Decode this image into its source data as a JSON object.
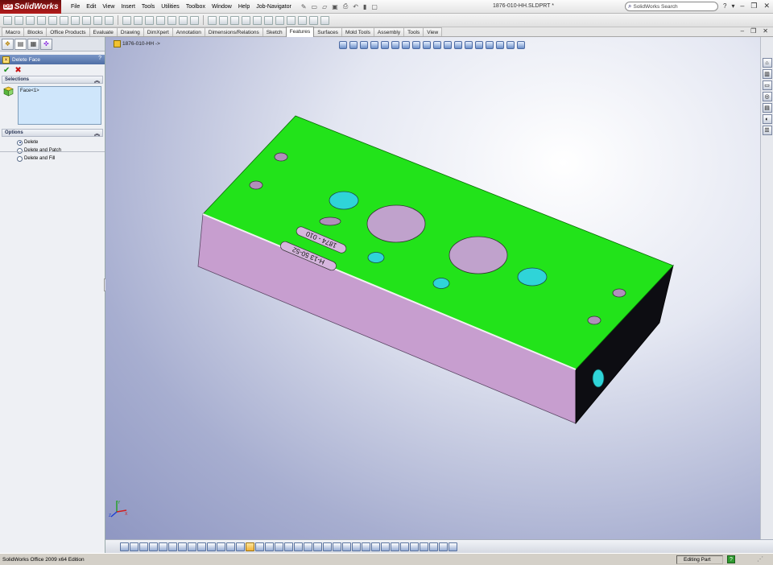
{
  "app": {
    "logo_text": "SolidWorks",
    "logo_mark": "DS",
    "menu": [
      "File",
      "Edit",
      "View",
      "Insert",
      "Tools",
      "Utilities",
      "Toolbox",
      "Window",
      "Help",
      "Job-Navigator"
    ],
    "document_title": "1876-010-HH.SLDPRT *",
    "search_placeholder": "SolidWorks Search",
    "help_glyph": "?"
  },
  "command_tabs": [
    "Macro",
    "Blocks",
    "Office Products",
    "Evaluate",
    "Drawing",
    "DimXpert",
    "Annotation",
    "Dimensions/Relations",
    "Sketch",
    "Features",
    "Surfaces",
    "Mold Tools",
    "Assembly",
    "Tools",
    "View"
  ],
  "active_tab": "Features",
  "property_manager": {
    "title": "Delete Face",
    "ok_glyph": "✔",
    "cancel_glyph": "✖",
    "selections": {
      "header": "Selections",
      "items_text": "Face<1>"
    },
    "options": {
      "header": "Options",
      "choices": [
        {
          "label": "Delete",
          "checked": true
        },
        {
          "label": "Delete and Patch",
          "checked": false
        },
        {
          "label": "Delete and Fill",
          "checked": false
        }
      ]
    }
  },
  "viewport": {
    "breadcrumb": "1876-010-HH ->",
    "engraving_1": "1874 - 010",
    "engraving_2": "H-13 50-52"
  },
  "colors": {
    "top_face": "#22e31a",
    "side_face": "#c79ecf",
    "end_face": "#0d0d12",
    "hole_fill": "#2fd4d8",
    "accent_blue": "#4f6ea5"
  },
  "statusbar": {
    "left": "SolidWorks Office 2009 x64 Edition",
    "mode": "Editing Part",
    "help_icon": "?"
  }
}
